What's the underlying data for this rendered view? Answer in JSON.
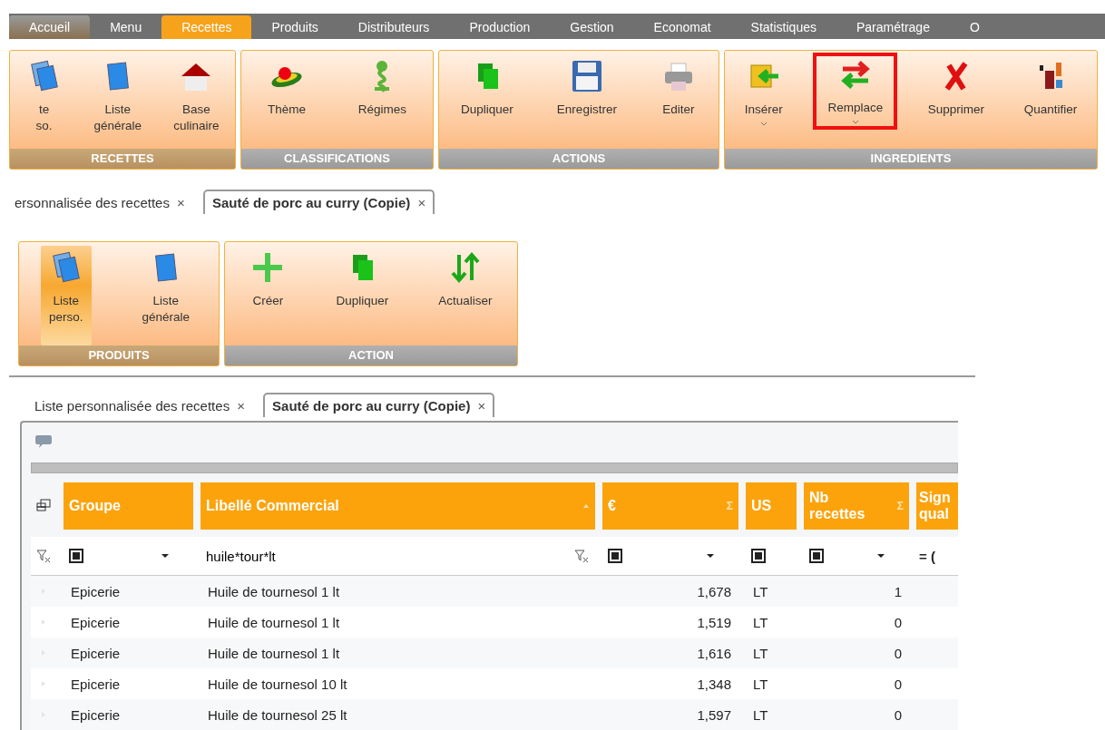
{
  "menu_bar": [
    {
      "label": "Accueil",
      "selected": false,
      "hover": true
    },
    {
      "label": "Menu",
      "selected": false,
      "hover": false
    },
    {
      "label": "Recettes",
      "selected": true,
      "hover": false
    },
    {
      "label": "Produits",
      "selected": false,
      "hover": false
    },
    {
      "label": "Distributeurs",
      "selected": false,
      "hover": false
    },
    {
      "label": "Production",
      "selected": false,
      "hover": false
    },
    {
      "label": "Gestion",
      "selected": false,
      "hover": false
    },
    {
      "label": "Economat",
      "selected": false,
      "hover": false
    },
    {
      "label": "Statistiques",
      "selected": false,
      "hover": false
    },
    {
      "label": "Paramétrage",
      "selected": false,
      "hover": false
    },
    {
      "label": "O",
      "selected": false,
      "hover": false
    }
  ],
  "ribbon": [
    {
      "title": "RECETTES",
      "buttons": [
        {
          "kind": "docs",
          "lines": [
            "te",
            "so."
          ],
          "selected": false,
          "dropdown": false,
          "highlighted": false
        },
        {
          "kind": "doc",
          "lines": [
            "Liste",
            "générale"
          ],
          "selected": false,
          "dropdown": false,
          "highlighted": false
        },
        {
          "kind": "house",
          "lines": [
            "Base",
            "culinaire"
          ],
          "selected": false,
          "dropdown": false,
          "highlighted": false
        }
      ]
    },
    {
      "title": "CLASSIFICATIONS",
      "buttons": [
        {
          "kind": "hat",
          "lines": [
            "Thème"
          ],
          "selected": false,
          "dropdown": false,
          "highlighted": false
        },
        {
          "kind": "tree",
          "lines": [
            "Régimes"
          ],
          "selected": false,
          "dropdown": false,
          "highlighted": false
        }
      ]
    },
    {
      "title": "ACTIONS",
      "buttons": [
        {
          "kind": "copy",
          "lines": [
            "Dupliquer"
          ],
          "selected": false,
          "dropdown": false,
          "highlighted": false
        },
        {
          "kind": "floppy",
          "lines": [
            "Enregistrer"
          ],
          "selected": false,
          "dropdown": false,
          "highlighted": false
        },
        {
          "kind": "printer",
          "lines": [
            "Editer"
          ],
          "selected": false,
          "dropdown": false,
          "highlighted": false
        }
      ]
    },
    {
      "title": "INGREDIENTS",
      "buttons": [
        {
          "kind": "insert",
          "lines": [
            "Insérer"
          ],
          "selected": false,
          "dropdown": true,
          "highlighted": false
        },
        {
          "kind": "swap",
          "lines": [
            "Remplace"
          ],
          "selected": false,
          "dropdown": true,
          "highlighted": true
        },
        {
          "kind": "cross",
          "lines": [
            "Supprimer"
          ],
          "selected": false,
          "dropdown": false,
          "highlighted": false
        },
        {
          "kind": "numbers",
          "lines": [
            "Quantifier"
          ],
          "selected": false,
          "dropdown": false,
          "highlighted": false
        }
      ]
    }
  ],
  "doc_tabs": [
    {
      "label": "ersonnalisée des recettes",
      "close": "×",
      "selected": false
    },
    {
      "label": "Sauté de porc au curry (Copie)",
      "close": "×",
      "selected": true
    }
  ],
  "ribbon_2": [
    {
      "title": "PRODUITS",
      "buttons": [
        {
          "kind": "docs",
          "lines": [
            "Liste",
            "perso."
          ],
          "selected": true,
          "dropdown": false,
          "highlighted": false
        },
        {
          "kind": "doc",
          "lines": [
            "Liste",
            "générale"
          ],
          "selected": false,
          "dropdown": false,
          "highlighted": false
        }
      ]
    },
    {
      "title": "ACTION",
      "buttons": [
        {
          "kind": "plus",
          "lines": [
            "Créer"
          ],
          "selected": false,
          "dropdown": false,
          "highlighted": false
        },
        {
          "kind": "copy",
          "lines": [
            "Dupliquer"
          ],
          "selected": false,
          "dropdown": false,
          "highlighted": false
        },
        {
          "kind": "updown",
          "lines": [
            "Actualiser"
          ],
          "selected": false,
          "dropdown": false,
          "highlighted": false
        }
      ]
    }
  ],
  "doc_tabs_2": [
    {
      "label": "Liste personnalisée des recettes",
      "close": "×",
      "selected": false
    },
    {
      "label": "Sauté de porc au curry (Copie)",
      "close": "×",
      "selected": true
    }
  ],
  "grid": {
    "columns": [
      {
        "label": "Groupe",
        "sort": false
      },
      {
        "label": "Libellé Commercial",
        "sort": true
      },
      {
        "label": "€",
        "sum": "Σ",
        "sort": false
      },
      {
        "label": "US",
        "sort": false
      },
      {
        "label": "Nb recettes",
        "sum": "Σ",
        "sort": false
      },
      {
        "label": "Sign qual",
        "sort": false
      }
    ],
    "filters": [
      {
        "kind": "select",
        "checked": true
      },
      {
        "kind": "text",
        "value": "huile*tour*lt"
      },
      {
        "kind": "select",
        "checked": true
      },
      {
        "kind": "check",
        "checked": true
      },
      {
        "kind": "select",
        "checked": true
      },
      {
        "kind": "operator",
        "value": "= ("
      }
    ],
    "rows": [
      [
        "Epicerie",
        "Huile de tournesol 1 lt",
        "1,678",
        "LT",
        "1"
      ],
      [
        "Epicerie",
        "Huile de tournesol 1 lt",
        "1,519",
        "LT",
        "0"
      ],
      [
        "Epicerie",
        "Huile de tournesol 1 lt",
        "1,616",
        "LT",
        "0"
      ],
      [
        "Epicerie",
        "Huile de tournesol 10 lt",
        "1,348",
        "LT",
        "0"
      ],
      [
        "Epicerie",
        "Huile de tournesol 25 lt",
        "1,597",
        "LT",
        "0"
      ]
    ]
  }
}
